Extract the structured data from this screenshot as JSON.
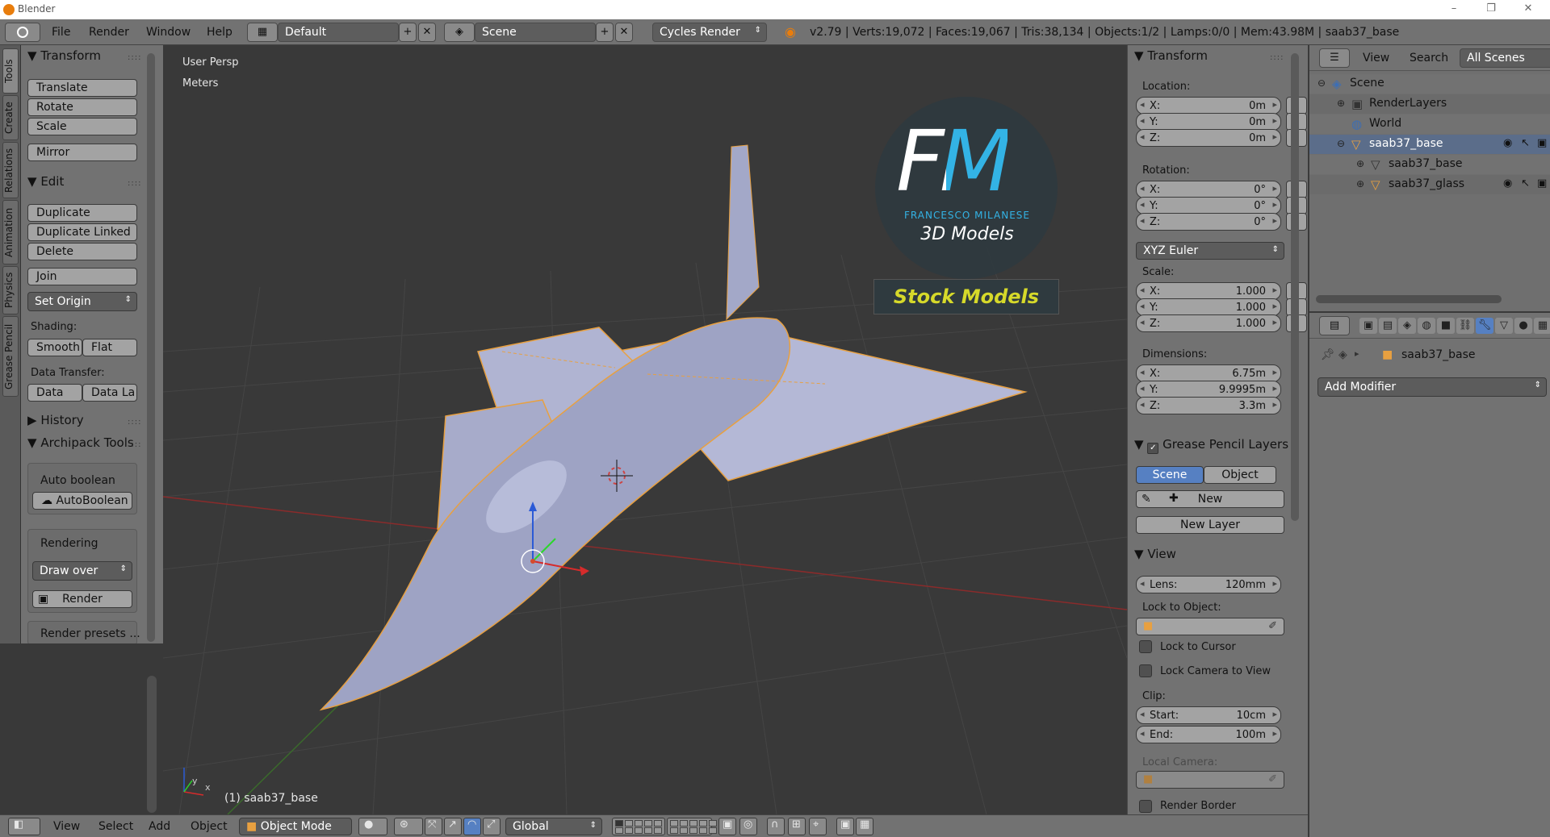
{
  "window": {
    "title": "Blender",
    "min": "–",
    "max": "❐",
    "close": "✕"
  },
  "info_header": {
    "menus": [
      "File",
      "Render",
      "Window",
      "Help"
    ],
    "layout": "Default",
    "scene": "Scene",
    "engine": "Cycles Render",
    "stats": "v2.79 | Verts:19,072 | Faces:19,067 | Tris:38,134 | Objects:1/2 | Lamps:0/0 | Mem:43.98M | saab37_base"
  },
  "vertical_tabs": [
    "Tools",
    "Create",
    "Relations",
    "Animation",
    "Physics",
    "Grease Pencil"
  ],
  "tool_shelf": {
    "transform": {
      "title": "Transform",
      "buttons": [
        "Translate",
        "Rotate",
        "Scale",
        "Mirror"
      ]
    },
    "edit": {
      "title": "Edit",
      "buttons": [
        "Duplicate",
        "Duplicate Linked",
        "Delete",
        "Join"
      ],
      "set_origin": "Set Origin",
      "shading_label": "Shading:",
      "smooth": "Smooth",
      "flat": "Flat",
      "data_transfer_label": "Data Transfer:",
      "data": "Data",
      "data_la": "Data La"
    },
    "history": {
      "title": "History"
    },
    "archipack": {
      "title": "Archipack Tools",
      "auto_boolean_label": "Auto boolean",
      "auto_boolean_btn": "AutoBoolean",
      "rendering_label": "Rendering",
      "draw_over": "Draw over",
      "render_btn": "Render",
      "render_presets": "Render presets ..."
    }
  },
  "viewport": {
    "view_name": "User Persp",
    "units": "Meters",
    "object_label": "(1) saab37_base",
    "watermark": {
      "big": "FM",
      "small": "FRANCESCO MILANESE",
      "sub": "3D Models",
      "banner": "Stock Models"
    },
    "axis_x": "x",
    "axis_y": "y"
  },
  "n_panel": {
    "transform_title": "Transform",
    "location_label": "Location:",
    "location": [
      {
        "k": "X:",
        "v": "0m"
      },
      {
        "k": "Y:",
        "v": "0m"
      },
      {
        "k": "Z:",
        "v": "0m"
      }
    ],
    "rotation_label": "Rotation:",
    "rotation": [
      {
        "k": "X:",
        "v": "0°"
      },
      {
        "k": "Y:",
        "v": "0°"
      },
      {
        "k": "Z:",
        "v": "0°"
      }
    ],
    "rotation_mode": "XYZ Euler",
    "scale_label": "Scale:",
    "scale": [
      {
        "k": "X:",
        "v": "1.000"
      },
      {
        "k": "Y:",
        "v": "1.000"
      },
      {
        "k": "Z:",
        "v": "1.000"
      }
    ],
    "dimensions_label": "Dimensions:",
    "dimensions": [
      {
        "k": "X:",
        "v": "6.75m"
      },
      {
        "k": "Y:",
        "v": "9.9995m"
      },
      {
        "k": "Z:",
        "v": "3.3m"
      }
    ],
    "grease_title": "Grease Pencil Layers",
    "scene_tab": "Scene",
    "object_tab": "Object",
    "new_btn": "New",
    "new_layer_btn": "New Layer",
    "view_title": "View",
    "lens_k": "Lens:",
    "lens_v": "120mm",
    "lock_to_object": "Lock to Object:",
    "lock_to_cursor": "Lock to Cursor",
    "lock_camera": "Lock Camera to View",
    "clip_label": "Clip:",
    "clip_start_k": "Start:",
    "clip_start_v": "10cm",
    "clip_end_k": "End:",
    "clip_end_v": "100m",
    "local_camera": "Local Camera:",
    "render_border": "Render Border"
  },
  "outliner": {
    "menus": [
      "View",
      "Search"
    ],
    "filter": "All Scenes",
    "items": [
      "Scene",
      "RenderLayers",
      "World",
      "saab37_base",
      "saab37_base",
      "saab37_glass"
    ]
  },
  "properties": {
    "object_name": "saab37_base",
    "add_modifier": "Add Modifier"
  },
  "bottom_header": {
    "menus": [
      "View",
      "Select",
      "Add",
      "Object"
    ],
    "mode": "Object Mode",
    "orientation": "Global"
  },
  "colors": {
    "selection": "#e8a040",
    "accent_blue": "#5680c2",
    "logo_cyan": "#33b3e5",
    "banner_yellow": "#d6d92a"
  }
}
